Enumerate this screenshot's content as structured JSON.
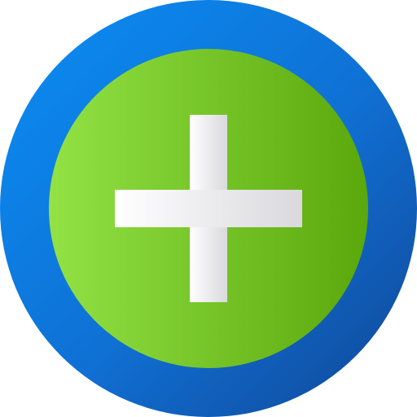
{
  "icon": {
    "name": "add-plus-icon",
    "colors": {
      "outer_ring_start": "#0a8ef5",
      "outer_ring_end": "#1457b8",
      "inner_disc_start": "#93e245",
      "inner_disc_end": "#5aa80c",
      "plus_start": "#ffffff",
      "plus_end": "#d9d9de"
    }
  }
}
